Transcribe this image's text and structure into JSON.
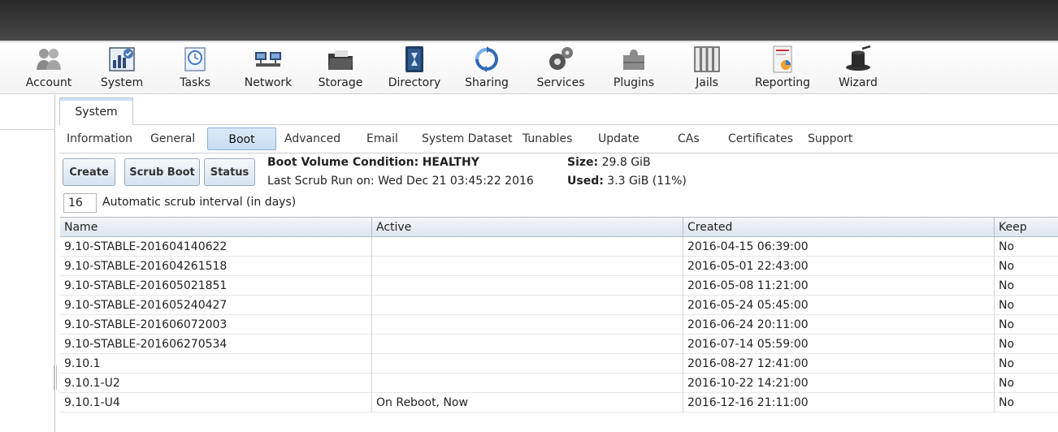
{
  "menu": [
    {
      "label": "Account",
      "icon": "account-icon"
    },
    {
      "label": "System",
      "icon": "system-icon"
    },
    {
      "label": "Tasks",
      "icon": "tasks-icon"
    },
    {
      "label": "Network",
      "icon": "network-icon"
    },
    {
      "label": "Storage",
      "icon": "storage-icon"
    },
    {
      "label": "Directory",
      "icon": "directory-icon"
    },
    {
      "label": "Sharing",
      "icon": "sharing-icon"
    },
    {
      "label": "Services",
      "icon": "services-icon"
    },
    {
      "label": "Plugins",
      "icon": "plugins-icon"
    },
    {
      "label": "Jails",
      "icon": "jails-icon"
    },
    {
      "label": "Reporting",
      "icon": "reporting-icon"
    },
    {
      "label": "Wizard",
      "icon": "wizard-icon"
    }
  ],
  "main_tab": "System",
  "subtabs": [
    "Information",
    "General",
    "Boot",
    "Advanced",
    "Email",
    "System Dataset",
    "Tunables",
    "Update",
    "CAs",
    "Certificates",
    "Support"
  ],
  "active_subtab": "Boot",
  "buttons": {
    "create": "Create",
    "scrub": "Scrub Boot",
    "status": "Status"
  },
  "boot": {
    "condition_label": "Boot Volume Condition:",
    "condition_value": "HEALTHY",
    "scrub_label": "Last Scrub Run on:",
    "scrub_value": "Wed Dec 21 03:45:22 2016",
    "size_label": "Size:",
    "size_value": "29.8 GiB",
    "used_label": "Used:",
    "used_value": "3.3 GiB (11%)"
  },
  "scrub_interval": {
    "value": "16",
    "label": "Automatic scrub interval (in days)"
  },
  "table": {
    "columns": [
      "Name",
      "Active",
      "Created",
      "Keep"
    ],
    "rows": [
      [
        "9.10-STABLE-201604140622",
        "",
        "2016-04-15 06:39:00",
        "No"
      ],
      [
        "9.10-STABLE-201604261518",
        "",
        "2016-05-01 22:43:00",
        "No"
      ],
      [
        "9.10-STABLE-201605021851",
        "",
        "2016-05-08 11:21:00",
        "No"
      ],
      [
        "9.10-STABLE-201605240427",
        "",
        "2016-05-24 05:45:00",
        "No"
      ],
      [
        "9.10-STABLE-201606072003",
        "",
        "2016-06-24 20:11:00",
        "No"
      ],
      [
        "9.10-STABLE-201606270534",
        "",
        "2016-07-14 05:59:00",
        "No"
      ],
      [
        "9.10.1",
        "",
        "2016-08-27 12:41:00",
        "No"
      ],
      [
        "9.10.1-U2",
        "",
        "2016-10-22 14:21:00",
        "No"
      ],
      [
        "9.10.1-U4",
        "On Reboot, Now",
        "2016-12-16 21:11:00",
        "No"
      ]
    ]
  }
}
